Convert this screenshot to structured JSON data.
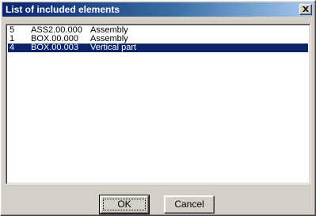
{
  "window": {
    "title": "List of included elements",
    "close_label": "×"
  },
  "list": {
    "items": [
      {
        "num": "5",
        "code": "ASS2.00.000",
        "type": "Assembly",
        "selected": false
      },
      {
        "num": "1",
        "code": "BOX.00.000",
        "type": "Assembly",
        "selected": false
      },
      {
        "num": "4",
        "code": "BOX.00.003",
        "type": "Vertical part",
        "selected": true
      }
    ]
  },
  "buttons": {
    "ok_label": "OK",
    "cancel_label": "Cancel"
  },
  "colors": {
    "selection": "#0a246a",
    "dialog_face": "#d4d0c8",
    "title_gradient_start": "#0a246a",
    "title_gradient_end": "#a6caf0"
  }
}
